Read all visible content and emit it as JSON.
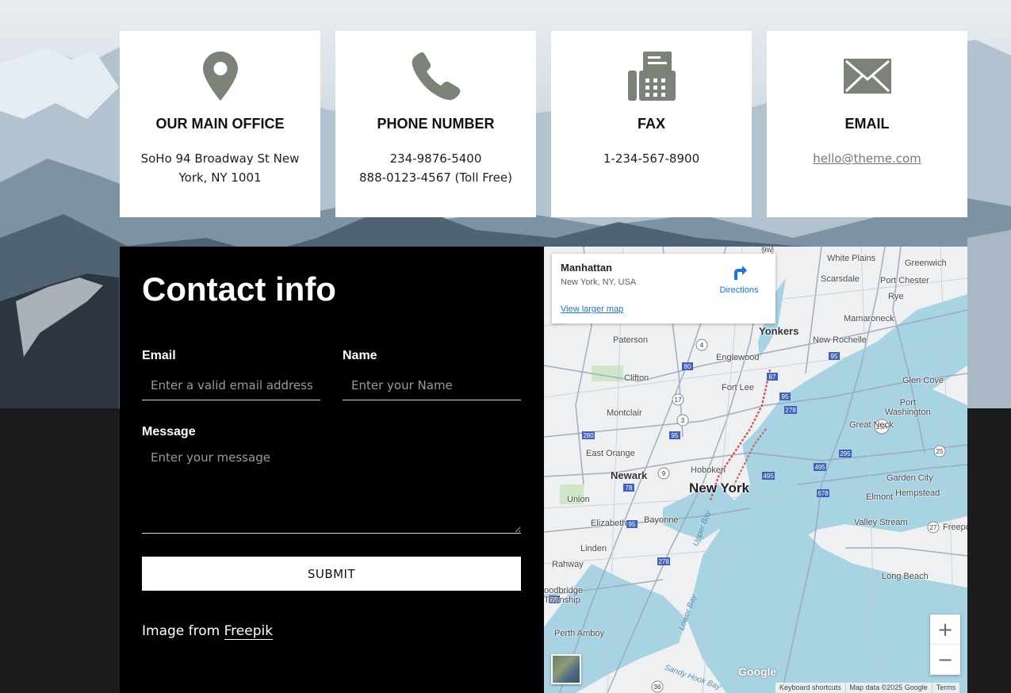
{
  "cards": [
    {
      "icon": "location-pin-icon",
      "title": "OUR MAIN OFFICE",
      "lines": [
        "SoHo 94 Broadway St New",
        "York, NY 1001"
      ]
    },
    {
      "icon": "phone-icon",
      "title": "PHONE NUMBER",
      "lines": [
        "234-9876-5400",
        "888-0123-4567 (Toll Free)"
      ]
    },
    {
      "icon": "fax-icon",
      "title": "FAX",
      "lines": [
        "1-234-567-8900"
      ]
    },
    {
      "icon": "envelope-icon",
      "title": "EMAIL",
      "link": "hello@theme.com"
    }
  ],
  "contact": {
    "heading": "Contact info",
    "email_label": "Email",
    "email_placeholder": "Enter a valid email address",
    "name_label": "Name",
    "name_placeholder": "Enter your Name",
    "message_label": "Message",
    "message_placeholder": "Enter your message",
    "submit_label": "SUBMIT",
    "credit_prefix": "Image from",
    "credit_link": "Freepik"
  },
  "map": {
    "place": "Manhattan",
    "address": "New York, NY, USA",
    "directions_label": "Directions",
    "larger_map_label": "View larger map",
    "zoom_in": "+",
    "zoom_out": "−",
    "google_logo": "Google",
    "attribution": [
      "Keyboard shortcuts",
      "Map data ©2025 Google",
      "Terms"
    ],
    "labels": {
      "white_plains": "White Plains",
      "greenwich": "Greenwich",
      "scarsdale": "Scarsdale",
      "port_chester": "Port Chester",
      "rye": "Rye",
      "mamaroneck": "Mamaroneck",
      "yonkers": "Yonkers",
      "paterson": "Paterson",
      "new_rochelle": "New Rochelle",
      "englewood": "Englewood",
      "clifton": "Clifton",
      "fort_lee": "Fort Lee",
      "glen_cove": "Glen Cove",
      "port_washington": "Port\nWashington",
      "montclair": "Montclair",
      "great_neck": "Great Neck",
      "east_orange": "East Orange",
      "hoboken": "Hoboken",
      "newark": "Newark",
      "new_york": "New York",
      "garden_city": "Garden City",
      "union": "Union",
      "elmont": "Elmont",
      "hempstead": "Hempstead",
      "elizabeth": "Elizabeth",
      "bayonne": "Bayonne",
      "valley_stream": "Valley Stream",
      "freeport": "Freeport",
      "linden": "Linden",
      "rahway": "Rahway",
      "long_beach": "Long Beach",
      "woodbridge": "oodbridge\nTownship",
      "perth_amboy": "Perth Amboy",
      "upper_bay": "Upper Bay",
      "lower_bay": "Lower Bay",
      "sandy_hook_bay": "Sandy Hook Bay"
    }
  },
  "colors": {
    "icon_gray": "#7b8278",
    "map_water": "#a7d3e3",
    "map_land": "#eef0f1",
    "link_blue": "#1a73e8"
  }
}
